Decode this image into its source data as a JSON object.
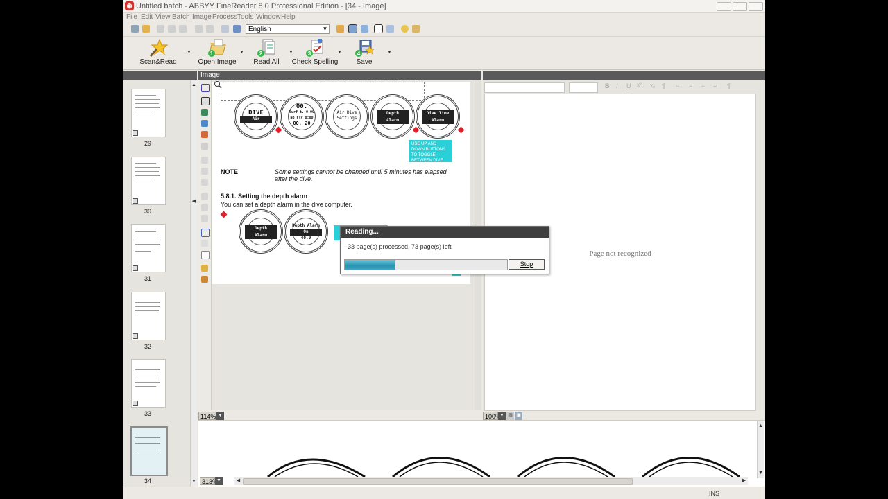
{
  "window": {
    "title": "Untitled batch - ABBYY FineReader 8.0 Professional Edition - [34 - Image]"
  },
  "menu": [
    "File",
    "Edit",
    "View",
    "Batch",
    "Image",
    "Process",
    "Tools",
    "Window",
    "Help"
  ],
  "quick_toolbar": {
    "language": "English"
  },
  "main_toolbar": {
    "buttons": [
      {
        "label": "Scan&Read",
        "step": ""
      },
      {
        "label": "Open Image",
        "step": "1"
      },
      {
        "label": "Read All",
        "step": "2"
      },
      {
        "label": "Check Spelling",
        "step": "3"
      },
      {
        "label": "Save",
        "step": "4"
      }
    ]
  },
  "panes": {
    "image_header": "Image",
    "image_zoom": "114%",
    "text_zoom": "100%",
    "zoom_pane_zoom": "313%"
  },
  "thumbnails": [
    {
      "page": "29",
      "selected": false
    },
    {
      "page": "30",
      "selected": false
    },
    {
      "page": "31",
      "selected": false
    },
    {
      "page": "32",
      "selected": false
    },
    {
      "page": "33",
      "selected": false
    },
    {
      "page": "34",
      "selected": true
    }
  ],
  "document": {
    "watches_top": [
      {
        "lines": [
          "DIVE",
          "Air"
        ]
      },
      {
        "lines": [
          "00.",
          "Surf t. 0:00",
          "No Fly 0:00",
          "00. 20"
        ]
      },
      {
        "lines": [
          "Air Dive",
          "Settings"
        ]
      },
      {
        "lines": [
          "Depth",
          "Alarm"
        ]
      },
      {
        "lines": [
          "Dive Time",
          "Alarm"
        ]
      }
    ],
    "callout": "USE UP AND DOWN BUTTONS TO TOGGLE BETWEEN DIVE SETTINGS",
    "note_label": "NOTE",
    "note_text": "Some settings cannot be changed until 5 minutes has elapsed after the dive.",
    "section_heading": "5.8.1. Setting the depth alarm",
    "section_text": "You can set a depth alarm in the dive computer.",
    "watches_bottom": [
      {
        "lines": [
          "Depth",
          "Alarm"
        ]
      },
      {
        "lines": [
          "Depth Alarm",
          "On",
          "40.0"
        ]
      }
    ]
  },
  "text_pane": {
    "message": "Page not recognized"
  },
  "dialog": {
    "title": "Reading...",
    "message": "33 page(s) processed, 73 page(s) left",
    "progress": 0.31,
    "stop_label": "Stop"
  },
  "status": {
    "mode": "INS"
  },
  "colors": {
    "progress": "#2a93b2",
    "callout": "#2ad0d8",
    "pane_header": "#5a5a5a"
  }
}
